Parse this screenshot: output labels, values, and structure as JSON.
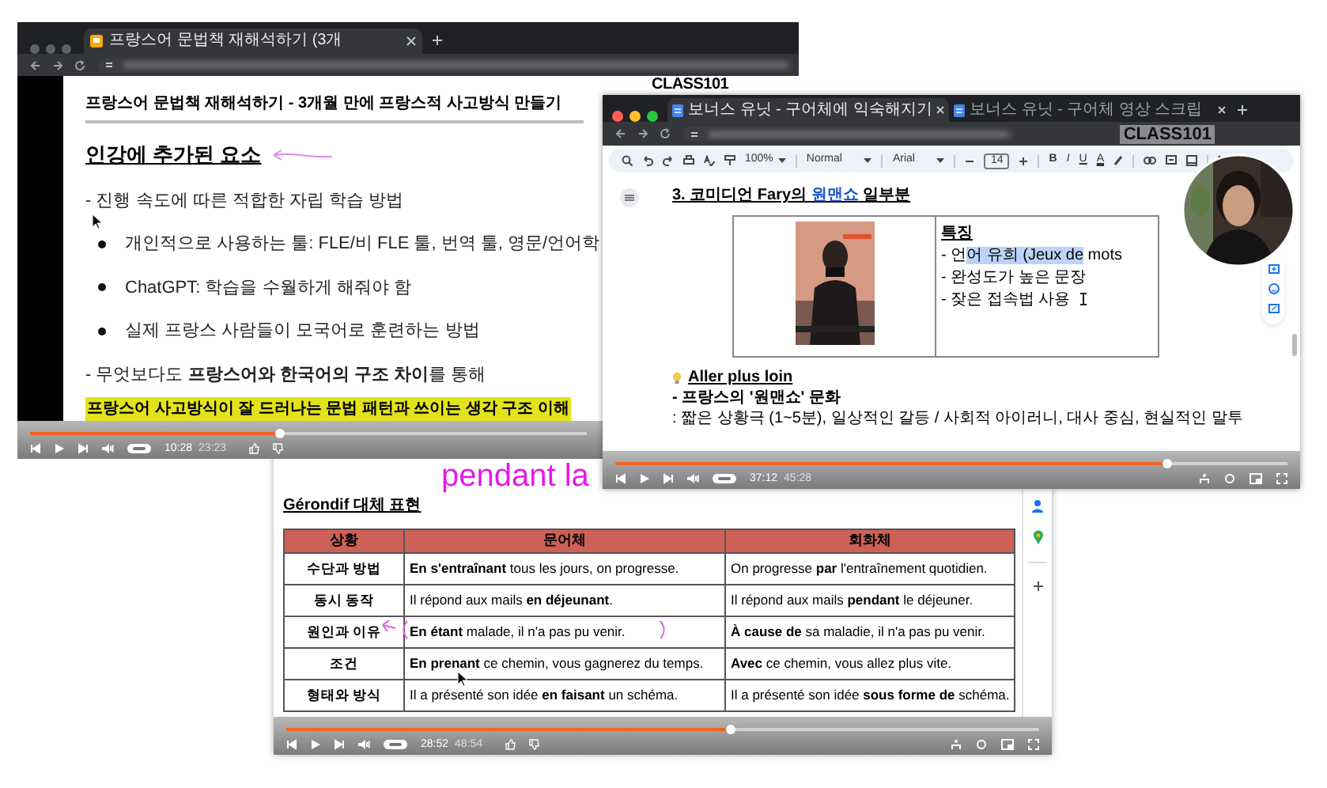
{
  "slides_window": {
    "tab": {
      "title": "프랑스어 문법책 재해석하기 (3개"
    },
    "logo": "CLASS101",
    "slide_title": "프랑스어 문법책 재해석하기 - 3개월 만에 프랑스적 사고방식 만들기",
    "heading": "인강에 추가된 요소",
    "lines": [
      {
        "kind": "dash",
        "text": "- 진행 속도에 따른 적합한 자립 학습 방법"
      },
      {
        "kind": "bullet",
        "text": "개인적으로 사용하는 툴: FLE/비 FLE 툴, 번역 툴, 영문/언어학"
      },
      {
        "kind": "bullet",
        "text": "ChatGPT: 학습을 수월하게 해줘야 함"
      },
      {
        "kind": "bullet",
        "text": "실제 프랑스 사람들이 모국어로 훈련하는 방법"
      },
      {
        "kind": "dash",
        "text": "- 무엇보다도 **프랑스어와 한국어의 구조 차이**를 통해"
      },
      {
        "kind": "highlight",
        "text": "프랑스어 사고방식이 잘 드러나는 문법 패턴과 쓰이는 생각 구조 이해"
      }
    ],
    "player": {
      "level": 0.45,
      "current_time": "10:28",
      "total_time": "23:23"
    }
  },
  "doc_window": {
    "tabs": [
      {
        "title": "보너스 유닛 - 구어체에 익숙해지기",
        "selected": true
      },
      {
        "title": "보너스 유닛 - 구어체 영상 스크립",
        "selected": false
      }
    ],
    "logo": "CLASS101",
    "toolbar": {
      "zoom": "100%",
      "style": "Normal",
      "font": "Arial",
      "font_size": "14",
      "format": [
        "B",
        "I",
        "U",
        "A"
      ]
    },
    "heading": {
      "before": "3. 코미디언 Fary의 ",
      "link": "원맨쇼",
      "after": " 일부분"
    },
    "notes": {
      "title": "특징",
      "items": [
        {
          "segments": [
            {
              "text": "- 언",
              "selected": false
            },
            {
              "text": "어 유희 (Jeux de",
              "selected": true
            },
            {
              "text": " mots",
              "selected": false
            }
          ]
        },
        {
          "segments": [
            {
              "text": "- 완성도가 높은 문장",
              "selected": false
            }
          ]
        },
        {
          "segments": [
            {
              "text": "- 잦은 접속법 사용",
              "selected": false
            }
          ]
        }
      ]
    },
    "extra": {
      "title": "Aller plus loin",
      "lines": [
        "- 프랑스의 '원맨쇼' 문화",
        ": 짧은 상황극 (1~5분), 일상적인 갈등 / 사회적 아이러니, 대사 중심, 현실적인 말투"
      ]
    },
    "player": {
      "level": 0.82,
      "current_time": "37:12",
      "total_time": "45:28"
    }
  },
  "table_window": {
    "annotation_text": "pendant la",
    "heading": "Gérondif 대체 표현",
    "table": {
      "columns": [
        "상황",
        "문어체",
        "회화체"
      ],
      "rows": [
        [
          "수단과 방법",
          "**En s'entraînant** tous les jours, on progresse.",
          "On progresse **par** l'entraînement quotidien."
        ],
        [
          "동시 동작",
          "Il répond aux mails **en déjeunant**.",
          "Il répond aux mails **pendant** le déjeuner."
        ],
        [
          "원인과 이유",
          "**En étant** malade, il n'a pas pu venir.",
          "**À cause de** sa maladie, il n'a pas pu venir."
        ],
        [
          "조건",
          "**En prenant** ce chemin, vous gagnerez du temps.",
          "**Avec** ce chemin, vous allez plus vite."
        ],
        [
          "형태와 방식",
          "Il a présenté son idée **en faisant** un schéma.",
          "Il a présenté son idée **sous forme de** schéma."
        ]
      ]
    },
    "player": {
      "level": 0.59,
      "current_time": "28:52",
      "total_time": "48:54"
    }
  }
}
